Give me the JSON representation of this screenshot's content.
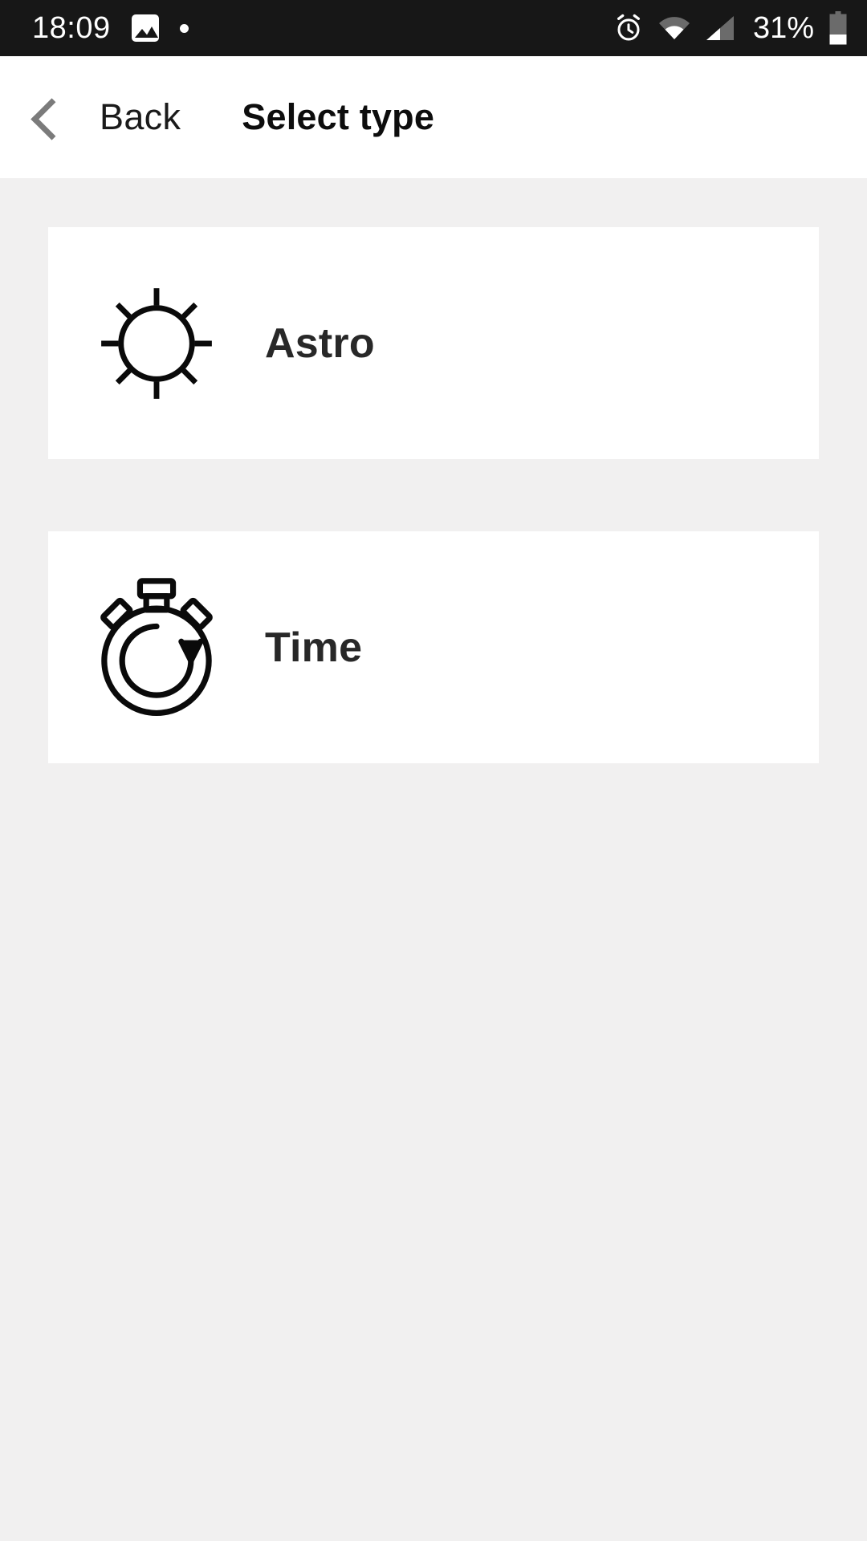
{
  "status_bar": {
    "time": "18:09",
    "battery_percent": "31%",
    "icons": [
      "photo-icon",
      "dot-icon",
      "alarm-icon",
      "wifi-icon",
      "cellular-signal-icon",
      "battery-icon"
    ],
    "background_color": "#171717",
    "foreground_color": "#ffffff"
  },
  "header": {
    "back_label": "Back",
    "title": "Select type",
    "back_icon": "chevron-left-icon",
    "background_color": "#ffffff",
    "chevron_color": "#7b7b7b"
  },
  "main": {
    "background_color": "#f1f0f0",
    "cards": [
      {
        "label": "Astro",
        "icon": "sun-icon"
      },
      {
        "label": "Time",
        "icon": "stopwatch-icon"
      }
    ]
  }
}
